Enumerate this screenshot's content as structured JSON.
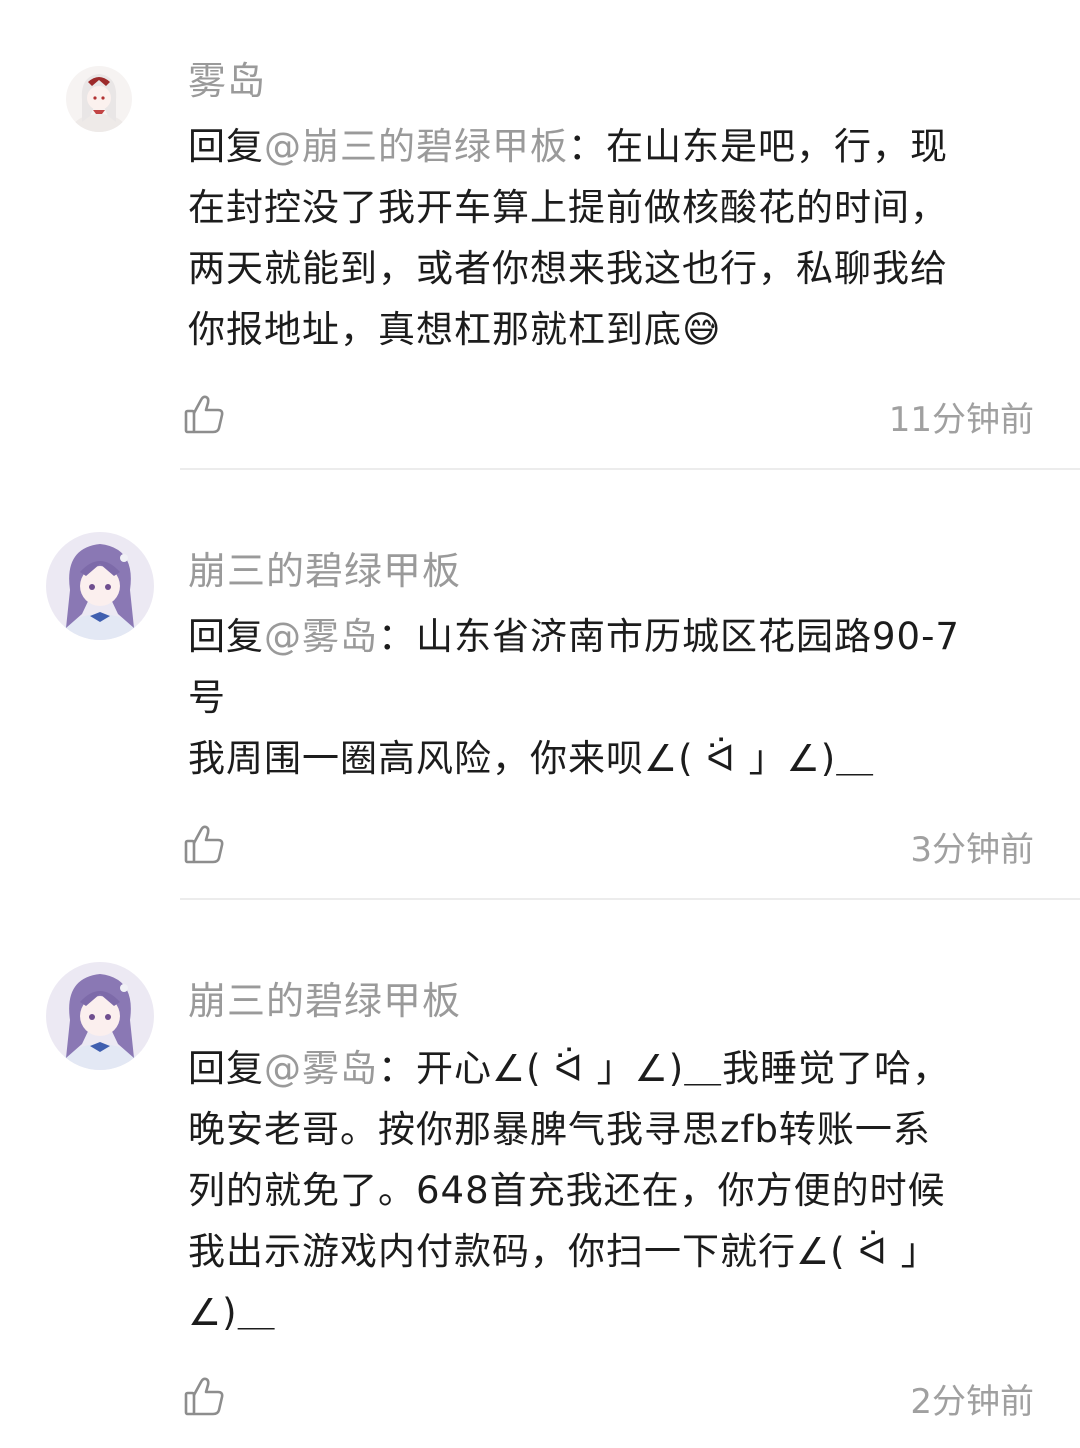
{
  "comments": [
    {
      "username": "雾岛",
      "avatar_icon": "avatar-maid-girl-icon",
      "reply_prefix": "回复",
      "mention": "@崩三的碧绿甲板",
      "lines": [
        "：在山东是吧，行，现",
        "在封控没了我开车算上提前做核酸花的时间，",
        "两天就能到，或者你想来我这也行，私聊我给",
        "你报地址，真想杠那就杠到底😅"
      ],
      "time": "11分钟前"
    },
    {
      "username": "崩三的碧绿甲板",
      "avatar_icon": "avatar-purple-hair-girl-icon",
      "reply_prefix": "回复",
      "mention": "@雾岛",
      "lines": [
        "：山东省济南市历城区花园路90-7",
        "号",
        "我周围一圈高风险，你来呗∠( ᐛ 」∠)＿"
      ],
      "time": "3分钟前"
    },
    {
      "username": "崩三的碧绿甲板",
      "avatar_icon": "avatar-purple-hair-girl-icon",
      "reply_prefix": "回复",
      "mention": "@雾岛",
      "lines": [
        "：开心∠( ᐛ 」∠)＿我睡觉了哈，",
        "晚安老哥。按你那暴脾气我寻思zfb转账一系",
        "列的就免了。648首充我还在，你方便的时候",
        "我出示游戏内付款码，你扫一下就行∠( ᐛ 」",
        "∠)＿"
      ],
      "time": "2分钟前"
    }
  ],
  "colors": {
    "username": "#9a9a9a",
    "text": "#1c1c1c",
    "time": "#a0a0a0",
    "divider": "#ececec"
  }
}
